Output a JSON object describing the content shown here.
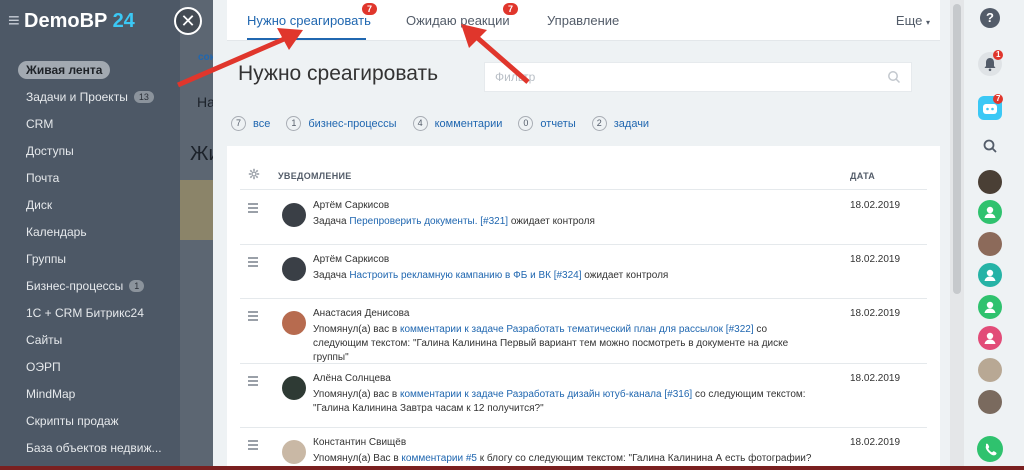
{
  "portal": {
    "name": "DemoBP",
    "number": "24"
  },
  "sidebar": {
    "items": [
      {
        "label": "Живая лента",
        "active": true
      },
      {
        "label": "Задачи и Проекты",
        "count": "13"
      },
      {
        "label": "CRM"
      },
      {
        "label": "Доступы"
      },
      {
        "label": "Почта"
      },
      {
        "label": "Диск"
      },
      {
        "label": "Календарь"
      },
      {
        "label": "Группы"
      },
      {
        "label": "Бизнес-процессы",
        "count": "1"
      },
      {
        "label": "1С + CRM Битрикс24"
      },
      {
        "label": "Сайты"
      },
      {
        "label": "ОЭРП"
      },
      {
        "label": "MindMap"
      },
      {
        "label": "Скрипты продаж"
      },
      {
        "label": "База объектов недвиж..."
      }
    ]
  },
  "background": {
    "frag1": "сок",
    "frag2": "На",
    "frag3": "Жи"
  },
  "tabs": [
    {
      "label": "Нужно среагировать",
      "badge": "7",
      "active": true
    },
    {
      "label": "Ожидаю реакции",
      "badge": "7"
    },
    {
      "label": "Управление"
    }
  ],
  "more_label": "Еще",
  "page_title": "Нужно среагировать",
  "filter": {
    "placeholder": "Фильтр"
  },
  "quick_filters": [
    {
      "count": "7",
      "label": "все"
    },
    {
      "count": "1",
      "label": "бизнес-процессы"
    },
    {
      "count": "4",
      "label": "комментарии"
    },
    {
      "count": "0",
      "label": "отчеты"
    },
    {
      "count": "2",
      "label": "задачи"
    }
  ],
  "table": {
    "col_notification": "УВЕДОМЛЕНИЕ",
    "col_date": "ДАТА",
    "rows": [
      {
        "author": "Артём Саркисов",
        "prefix": "Задача ",
        "link": "Перепроверить документы. [#321]",
        "suffix": " ожидает контроля",
        "date": "18.02.2019"
      },
      {
        "author": "Артём Саркисов",
        "prefix": "Задача ",
        "link": "Настроить рекламную кампанию в ФБ и ВК [#324]",
        "suffix": " ожидает контроля",
        "date": "18.02.2019"
      },
      {
        "author": "Анастасия Денисова",
        "prefix": "Упомянул(а) вас в ",
        "link": "комментарии к задаче Разработать тематический план для рассылок [#322]",
        "suffix": " со следующим текстом: \"Галина Калинина Первый вариант тем можно посмотреть в документе на диске группы\"",
        "date": "18.02.2019"
      },
      {
        "author": "Алёна Солнцева",
        "prefix": "Упомянул(а) вас в ",
        "link": "комментарии к задаче Разработать дизайн ютуб-канала [#316]",
        "suffix": " со следующим текстом: \"Галина Калинина Завтра часам к 12 получится?\"",
        "date": "18.02.2019"
      },
      {
        "author": "Константин Свищёв",
        "prefix": "Упомянул(а) Вас в ",
        "link": "комментарии #5",
        "suffix": " к блогу со следующим текстом: \"Галина Калинина А есть фотографии? И",
        "date": "18.02.2019"
      }
    ]
  },
  "right_bar": {
    "notif_badge": "1",
    "messenger_badge": "7"
  },
  "colors": {
    "accent": "#2067b0",
    "badge": "#e0362c",
    "arrow": "#e0362c",
    "online": "#2fc26e"
  }
}
